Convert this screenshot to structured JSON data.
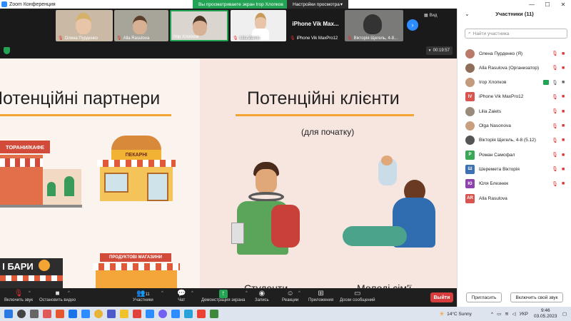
{
  "window": {
    "title": "Zoom Конференция"
  },
  "share_banner": {
    "text": "Вы просматриваете экран Ігор Хлопков",
    "view_options": "Настройки просмотра"
  },
  "gallery": {
    "tiles": [
      {
        "name": "Олена Пурденко",
        "muted": true
      },
      {
        "name": "Alla Rasulova",
        "muted": true
      },
      {
        "name": "Ігор Хлопков",
        "muted": false
      },
      {
        "name": "Lilia Zaiets",
        "muted": true
      },
      {
        "name": "iPhone Vik MaxPro12",
        "big_name": "iPhone Vik Max...",
        "muted": true
      },
      {
        "name": "Вікторія Щегель, 4-8...",
        "muted": true
      }
    ],
    "view_label": "Вид"
  },
  "meeting": {
    "timer": "00:19:57"
  },
  "slide": {
    "left_title": "Потенційні партнери",
    "right_title": "Потенційні клієнти",
    "right_subtitle": "(для початку)",
    "signs": {
      "restaurants": "ТОРАНИ/КАФЕ",
      "bakery": "ПЕКАРНІ",
      "bars": "І БАРИ",
      "grocery": "ПРОДУКТОВІ МАГАЗИНИ"
    },
    "captions": {
      "students": "Студенти",
      "parents": "Молоді сім'ї"
    }
  },
  "toolbar": {
    "audio": "Включить звук",
    "video": "Остановить видео",
    "participants": "Участники",
    "participants_count": "11",
    "chat": "Чат",
    "share": "Демонстрация экрана",
    "record": "Запись",
    "reactions": "Реакции",
    "apps": "Приложения",
    "whiteboards": "Доски сообщений",
    "leave": "Выйти"
  },
  "participants_panel": {
    "title": "Участники (11)",
    "search_placeholder": "Найти участника",
    "people": [
      {
        "name": "Олена Пурденко (Я)",
        "avatar": "",
        "color": "#b97a6a",
        "mic_muted": true,
        "cam_off": true,
        "sharing": false
      },
      {
        "name": "Alla Rasulova (Организатор)",
        "avatar": "",
        "color": "#8e6e5b",
        "mic_muted": true,
        "cam_off": true,
        "sharing": false
      },
      {
        "name": "Ігор Хлопков",
        "avatar": "",
        "color": "#c49a7c",
        "mic_muted": false,
        "cam_off": false,
        "sharing": true
      },
      {
        "name": "iPhone Vik MaxPro12",
        "avatar": "IV",
        "color": "#d9534f",
        "mic_muted": true,
        "cam_off": true,
        "sharing": false
      },
      {
        "name": "Lilia Zaiets",
        "avatar": "",
        "color": "#9a8a7a",
        "mic_muted": true,
        "cam_off": true,
        "sharing": false
      },
      {
        "name": "Olga Nasonova",
        "avatar": "",
        "color": "#c8a080",
        "mic_muted": true,
        "cam_off": true,
        "sharing": false
      },
      {
        "name": "Вікторія Щегель, 4-8 (5.12)",
        "avatar": "",
        "color": "#555555",
        "mic_muted": true,
        "cam_off": true,
        "sharing": false
      },
      {
        "name": "Роман Самофал",
        "avatar": "Р",
        "color": "#3aa757",
        "mic_muted": true,
        "cam_off": true,
        "sharing": false
      },
      {
        "name": "Шереметa Вікторія",
        "avatar": "Ш",
        "color": "#3d6fb4",
        "mic_muted": true,
        "cam_off": true,
        "sharing": false
      },
      {
        "name": "Юля Блезнюк",
        "avatar": "Ю",
        "color": "#8e44ad",
        "mic_muted": true,
        "cam_off": true,
        "sharing": false
      },
      {
        "name": "Alla Rasulova",
        "avatar": "AR",
        "color": "#d9534f",
        "mic_muted": false,
        "cam_off": false,
        "sharing": false
      }
    ],
    "invite": "Пригласить",
    "unmute_self": "Включить свой звук"
  },
  "taskbar": {
    "weather": "14°C  Sunny",
    "lang": "УКР",
    "time": "9:46",
    "date": "03.05.2023"
  }
}
